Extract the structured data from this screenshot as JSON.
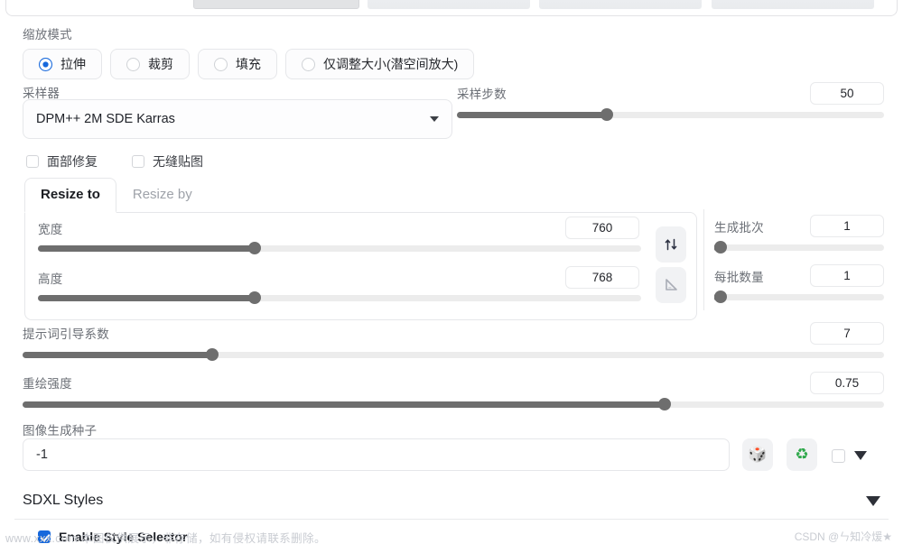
{
  "top_strip": {
    "chips": [
      "",
      "",
      "",
      ""
    ]
  },
  "scale_mode": {
    "title": "缩放模式",
    "options": [
      {
        "label": "拉伸",
        "selected": true
      },
      {
        "label": "裁剪",
        "selected": false
      },
      {
        "label": "填充",
        "selected": false
      },
      {
        "label": "仅调整大小(潜空间放大)",
        "selected": false
      }
    ]
  },
  "sampler": {
    "label": "采样器",
    "value": "DPM++ 2M SDE Karras",
    "caret_icon": "chevron-down-icon"
  },
  "steps": {
    "label": "采样步数",
    "value": "50",
    "slider_percent": 35
  },
  "toggles": [
    {
      "label": "面部修复",
      "checked": false
    },
    {
      "label": "无缝贴图",
      "checked": false
    }
  ],
  "resize": {
    "tabs": [
      {
        "label": "Resize to",
        "active": true
      },
      {
        "label": "Resize by",
        "active": false
      }
    ],
    "width": {
      "label": "宽度",
      "value": "760",
      "slider_percent": 36
    },
    "height": {
      "label": "高度",
      "value": "768",
      "slider_percent": 36
    },
    "swap_button_icon": "swap-vertical-icon",
    "aspect_button_icon": "triangle-ruler-icon"
  },
  "batch": {
    "count": {
      "label": "生成批次",
      "value": "1",
      "slider_percent": 2
    },
    "size": {
      "label": "每批数量",
      "value": "1",
      "slider_percent": 2
    }
  },
  "cfg": {
    "label": "提示词引导系数",
    "value": "7",
    "slider_percent": 22
  },
  "denoise": {
    "label": "重绘强度",
    "value": "0.75",
    "slider_percent": 74.5
  },
  "seed": {
    "label": "图像生成种子",
    "value": "-1",
    "buttons": [
      {
        "icon": "dice-icon",
        "glyph": "🎲"
      },
      {
        "icon": "recycle-icon",
        "glyph": "♻"
      }
    ],
    "extra_checkbox_checked": false,
    "extra_caret_icon": "chevron-down-icon"
  },
  "sdxl_styles": {
    "title": "SDXL Styles",
    "caret_icon": "chevron-down-icon",
    "enable_selector": {
      "label": "Enable Style Selector",
      "checked": true
    }
  },
  "watermarks": {
    "left": "www.xxx.com 本图仅供展示，非存储，如有侵权请联系删除。",
    "right": "CSDN @ㄣ知冷煖★"
  },
  "colors": {
    "accent": "#1668dc",
    "slider_fill": "#6e6e6e",
    "slider_track": "#ececec",
    "border": "#e6e7ea",
    "label_text": "#6b6f76"
  }
}
